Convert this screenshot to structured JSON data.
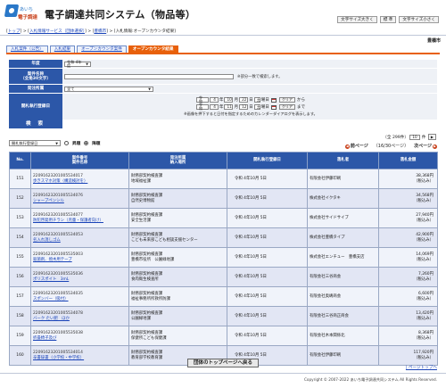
{
  "header": {
    "logo_top": "あいち",
    "logo_bottom": "電子調達",
    "title": "電子調達共同システム（物品等）",
    "font_buttons": [
      "文字サイズ大きく",
      "標 準",
      "文字サイズ小さく"
    ]
  },
  "breadcrumb": {
    "items": [
      "トップ",
      "入札情報サービス（団体選択）",
      "豊橋市",
      "入札情報:オープンカウンタ結果"
    ],
    "separator": ">"
  },
  "org_name": "豊橋市",
  "tabs": [
    {
      "label": "入札案件（公告）",
      "active": false
    },
    {
      "label": "入札結果",
      "active": false
    },
    {
      "label": "オープンカウンタ案件",
      "active": false
    },
    {
      "label": "オープンカウンタ結果",
      "active": true
    }
  ],
  "form": {
    "fiscal_year_label": "年度",
    "fiscal_year_value": "令和 4年度",
    "case_name_label": "案件名称\n（全角30文字）",
    "case_name_note": "※部分一致で検索します。",
    "dept_label": "発注所属",
    "dept_value": "全て",
    "date_label": "開札執行登録日",
    "from": {
      "era": "令和",
      "year": "4",
      "month": "10",
      "day": "22",
      "weekday": "土",
      "clear": "クリア",
      "suffix": "から"
    },
    "to": {
      "era": "令和",
      "year": "4",
      "month": "11",
      "day": "12",
      "weekday": "土",
      "clear": "クリア",
      "suffix": "まで"
    },
    "year_unit": "年",
    "month_unit": "月",
    "day_unit": "日",
    "weekday_unit": "曜日",
    "calendar_note": "※画像を押下すると日付を指定するためのカレンダーダイアログを表示します。",
    "search_button": "検 索"
  },
  "sort": {
    "select_value": "開札執行登録日",
    "asc_label": "昇順",
    "desc_label": "降順",
    "selected": "desc"
  },
  "pager": {
    "total_text": "全 299件",
    "per_page": "10",
    "per_page_unit": "件",
    "page_text": "16/30ページ",
    "prev_label": "前ページ",
    "next_label": "次ページ"
  },
  "table": {
    "headers": [
      "No.",
      "案件番号\n案件名称",
      "発注所属\n納入場所",
      "開札執行登録日",
      "落札者",
      "落札金額"
    ],
    "rows": [
      {
        "no": "151",
        "case_no": "22091623201005534017",
        "case_name": "歩きスマホ対策（構造検討を）",
        "dept": "財務部契約検査課",
        "place": "地域福祉課",
        "date": "令和 4年10月 5日",
        "winner": "有限会社伊藤印刷",
        "amount": "38,368円",
        "tax": "（税込み）"
      },
      {
        "no": "152",
        "case_no": "22091623201005534076",
        "case_name": "シャープペンシル",
        "dept": "財務部契約検査課",
        "place": "自然史博物館",
        "date": "令和 4年10月 5日",
        "winner": "株式会社イクタキ",
        "amount": "34,568円",
        "tax": "（税込み）"
      },
      {
        "no": "153",
        "case_no": "22091623201005534077",
        "case_name": "防犯啓発用チラシ（児童・保護者向け）",
        "dept": "財務部契約検査課",
        "place": "安全生活課",
        "date": "令和 4年10月 5日",
        "winner": "株式会社サイドサイブ",
        "amount": "27,940円",
        "tax": "（税込み）"
      },
      {
        "no": "154",
        "case_no": "22091623201005534053",
        "case_name": "名入れ消しゴム",
        "dept": "財務部契約検査課",
        "place": "こども未来部こども相談支援センター",
        "date": "令和 4年10月 5日",
        "winner": "株式会社豊橋タイプ",
        "amount": "42,900円",
        "tax": "（税込み）"
      },
      {
        "no": "155",
        "case_no": "22091623201005535003",
        "case_name": "殺菌剤、焼木用テープ",
        "dept": "財務部契約検査課",
        "place": "豊橋市役所　公園緑地課",
        "date": "令和 4年10月 5日",
        "winner": "株式会社エンチュー　豊橋支店",
        "amount": "14,069円",
        "tax": "（税込み）"
      },
      {
        "no": "156",
        "case_no": "22091623201005535036",
        "case_name": "ポリスポイト　3mL",
        "dept": "財務部契約検査課",
        "place": "食肉衛生検査所",
        "date": "令和 4年10月 5日",
        "winner": "有限会社三谷商会",
        "amount": "7,260円",
        "tax": "（税込み）"
      },
      {
        "no": "157",
        "case_no": "22091623201005534035",
        "case_name": "スポンバー（吸付）",
        "dept": "財務部契約検査課",
        "place": "福祉事務所所救所防課",
        "date": "令和 4年10月 5日",
        "winner": "有限会社奥嶋商会",
        "amount": "6,600円",
        "tax": "（税込み）"
      },
      {
        "no": "158",
        "case_no": "22091623201005534078",
        "case_name": "バーク たい肥　ほか",
        "dept": "財務部契約検査課",
        "place": "公園緑地課",
        "date": "令和 4年10月 5日",
        "winner": "有限会社三谷商正商会",
        "amount": "13,420円",
        "tax": "（税込み）"
      },
      {
        "no": "159",
        "case_no": "22091623201005535038",
        "case_name": "折畳椅子及び",
        "dept": "財務部契約検査課",
        "place": "保健所こども保健課",
        "date": "令和 4年10月 5日",
        "winner": "有限会社木本関係北",
        "amount": "8,368円",
        "tax": "（税込み）"
      },
      {
        "no": "160",
        "case_no": "22091623201005534014",
        "case_name": "辛書辞書（小学校・中学校）",
        "dept": "財務部契約検査課",
        "place": "教育部学校教育課",
        "date": "令和 4年10月 5日",
        "winner": "有限会社伊藤印刷",
        "amount": "117,920円",
        "tax": "（税込み）"
      }
    ]
  },
  "back_button": "団体のトップページへ戻る",
  "page_top": "| ページトップへ",
  "footer": "Copyright © 2007-2022 あいち電子調達共同システム All Rights Reserved."
}
